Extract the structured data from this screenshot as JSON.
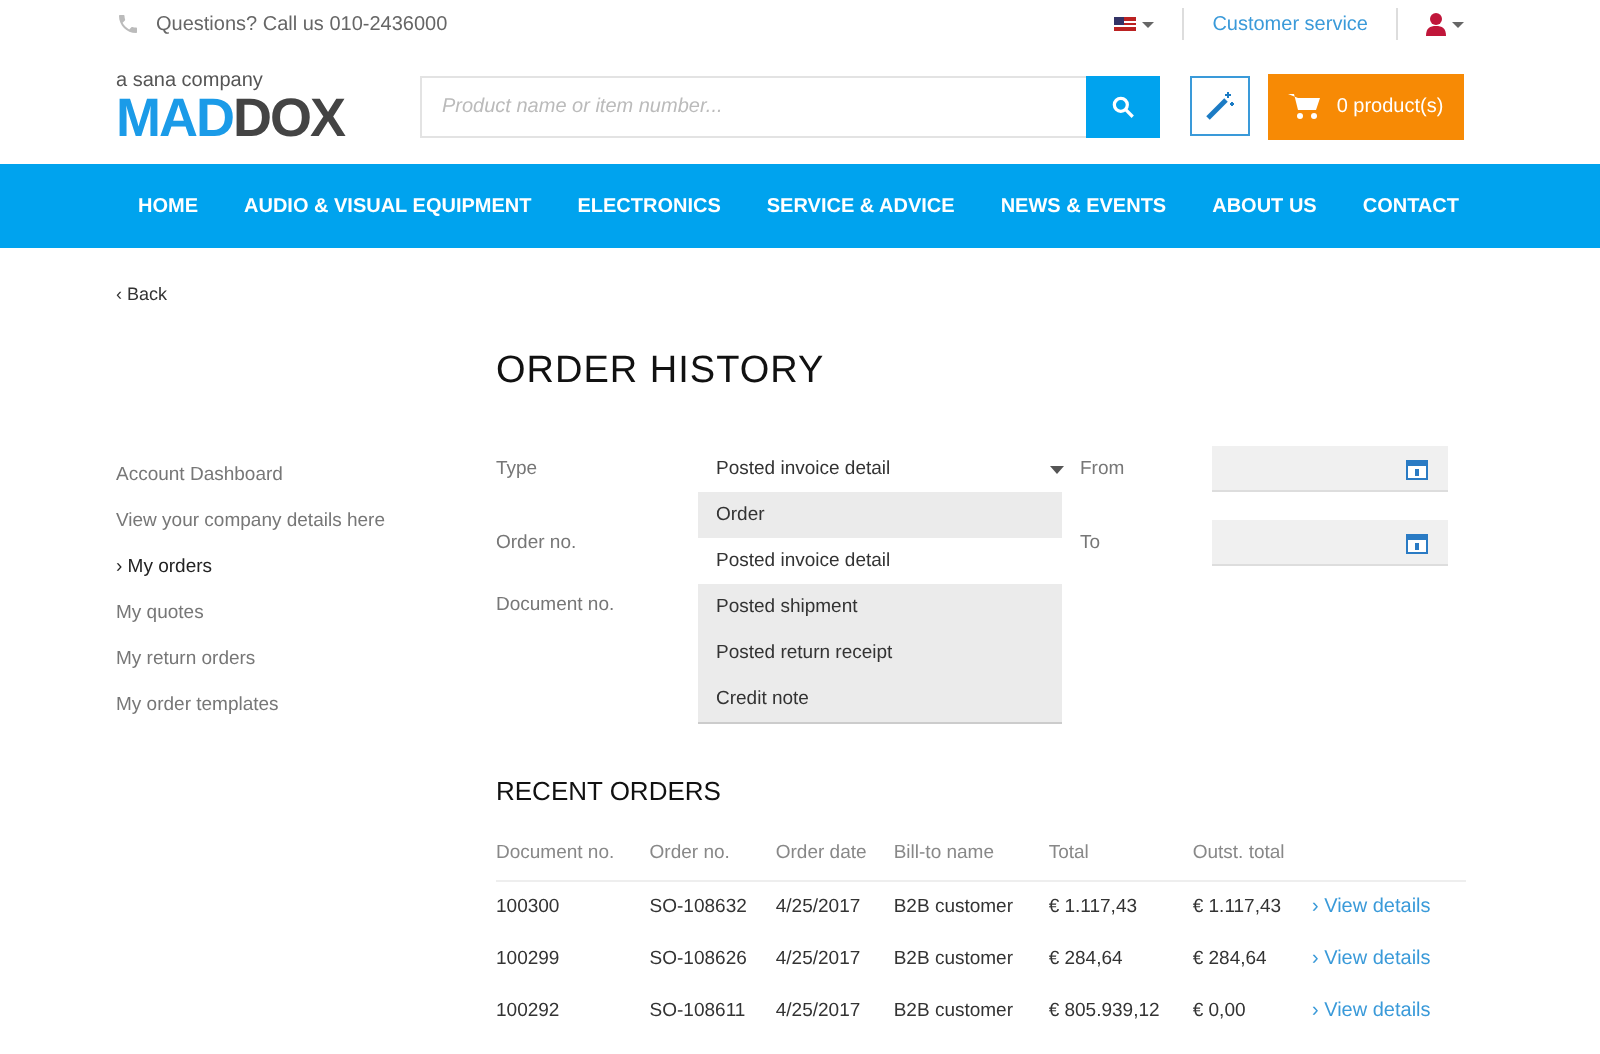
{
  "topbar": {
    "phone": "Questions? Call us 010-2436000",
    "customer_service": "Customer service"
  },
  "header": {
    "tagline": "a sana company",
    "logo_left": "MAD",
    "logo_right": "DOX",
    "search": {
      "placeholder": "Product name or item number..."
    },
    "cart": "0 product(s)"
  },
  "nav": [
    "HOME",
    "AUDIO & VISUAL EQUIPMENT",
    "ELECTRONICS",
    "SERVICE & ADVICE",
    "NEWS & EVENTS",
    "ABOUT US",
    "CONTACT"
  ],
  "back": "‹ Back",
  "title": "ORDER HISTORY",
  "sidebar": [
    {
      "label": "Account Dashboard",
      "selected": false
    },
    {
      "label": "View your company details here",
      "selected": false
    },
    {
      "label": "› My orders",
      "selected": true
    },
    {
      "label": "My quotes",
      "selected": false
    },
    {
      "label": "My return orders",
      "selected": false
    },
    {
      "label": "My order templates",
      "selected": false
    }
  ],
  "filters": {
    "type_label": "Type",
    "type_value": "Posted invoice detail",
    "order_label": "Order no.",
    "document_label": "Document no.",
    "from_label": "From",
    "to_label": "To",
    "options": [
      {
        "label": "Order",
        "selected": false
      },
      {
        "label": "Posted invoice detail",
        "selected": true
      },
      {
        "label": "Posted shipment",
        "selected": false
      },
      {
        "label": "Posted return receipt",
        "selected": false
      },
      {
        "label": "Credit note",
        "selected": false
      }
    ]
  },
  "recent": {
    "title": "RECENT ORDERS",
    "columns": [
      "Document no.",
      "Order no.",
      "Order date",
      "Bill-to name",
      "Total",
      "Outst. total"
    ],
    "rows": [
      {
        "cells": [
          "100300",
          "SO-108632",
          "4/25/2017",
          "B2B customer",
          "€ 1.117,43",
          "€ 1.117,43"
        ],
        "link": "› View details"
      },
      {
        "cells": [
          "100299",
          "SO-108626",
          "4/25/2017",
          "B2B customer",
          "€ 284,64",
          "€ 284,64"
        ],
        "link": "› View details"
      },
      {
        "cells": [
          "100292",
          "SO-108611",
          "4/25/2017",
          "B2B customer",
          "€ 805.939,12",
          "€ 0,00"
        ],
        "link": "› View details"
      }
    ]
  }
}
